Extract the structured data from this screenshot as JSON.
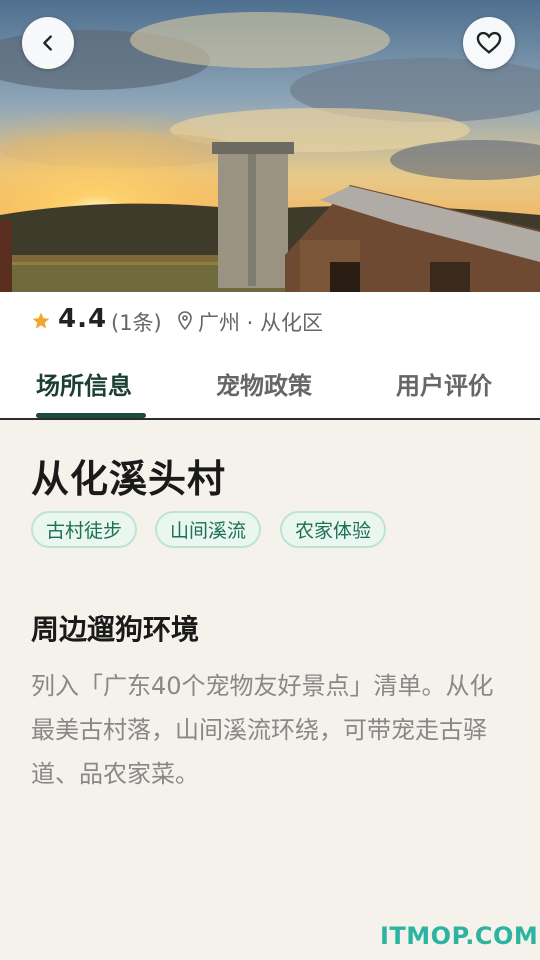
{
  "place": {
    "name": "从化溪头村",
    "rating": "4.4",
    "review_count": "(1条)",
    "location": "广州 · 从化区",
    "tags": [
      "古村徒步",
      "山间溪流",
      "农家体验"
    ]
  },
  "tabs": [
    {
      "label": "场所信息",
      "active": true
    },
    {
      "label": "宠物政策",
      "active": false
    },
    {
      "label": "用户评价",
      "active": false
    }
  ],
  "section": {
    "title": "周边遛狗环境",
    "description": "列入「广东40个宠物友好景点」清单。从化最美古村落，山间溪流环绕，可带宠走古驿道、品农家菜。"
  },
  "watermark": "ITMOP.COM",
  "icons": {
    "back": "chevron-left-icon",
    "favorite": "heart-icon",
    "rating": "star-icon",
    "location": "map-pin-icon"
  },
  "colors": {
    "accent": "#1f4a3a",
    "star": "#f2a531",
    "chip_text": "#1e7055",
    "chip_bg": "#eaf6f0",
    "watermark": "#2db4a0"
  }
}
